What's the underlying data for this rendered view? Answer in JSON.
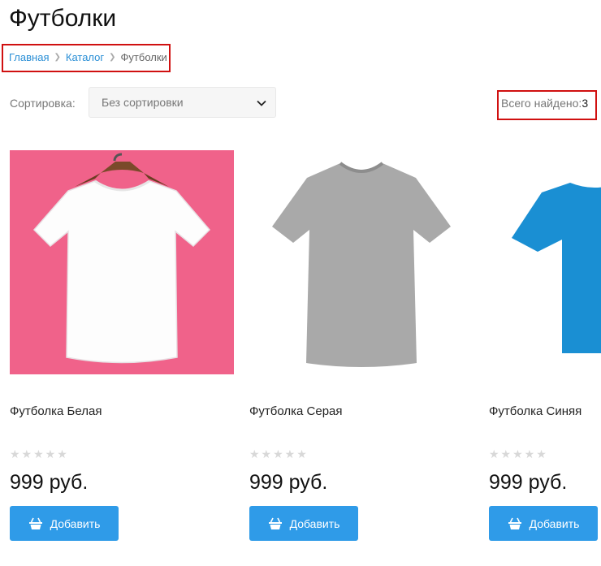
{
  "page": {
    "title": "Футболки"
  },
  "breadcrumb": {
    "home": "Главная",
    "catalog": "Каталог",
    "current": "Футболки"
  },
  "sort": {
    "label": "Сортировка:",
    "value": "Без сортировки"
  },
  "found": {
    "label": "Всего найдено:",
    "count": "3"
  },
  "products": [
    {
      "name": "Футболка Белая",
      "price": "999 руб.",
      "rating": "★★★★★",
      "button": "Добавить",
      "image_background": "#f0628a",
      "shirt_color": "#ffffff"
    },
    {
      "name": "Футболка Серая",
      "price": "999 руб.",
      "rating": "★★★★★",
      "button": "Добавить",
      "image_background": "#ffffff",
      "shirt_color": "#a9a9a9"
    },
    {
      "name": "Футболка Синяя",
      "price": "999 руб.",
      "rating": "★★★★★",
      "button": "Добавить",
      "image_background": "#ffffff",
      "shirt_color": "#1a8fd3"
    }
  ],
  "colors": {
    "link": "#2a8fd6",
    "button": "#2f9be8",
    "highlight_border": "#d01010"
  }
}
